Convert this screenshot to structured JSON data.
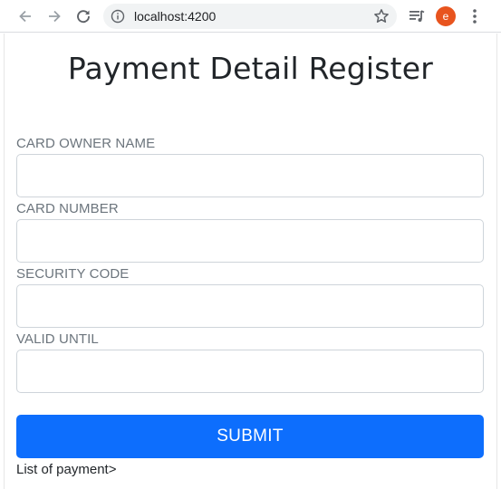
{
  "browser": {
    "url": "localhost:4200",
    "avatar_letter": "e",
    "avatar_color": "#e8541e",
    "icons": [
      "back-arrow-icon",
      "forward-arrow-icon",
      "reload-icon",
      "info-icon",
      "star-icon",
      "media-queue-icon",
      "menu-dots-icon"
    ]
  },
  "page": {
    "title": "Payment Detail Register",
    "fields": [
      {
        "label": "CARD OWNER NAME",
        "value": ""
      },
      {
        "label": "CARD NUMBER",
        "value": ""
      },
      {
        "label": "SECURITY CODE",
        "value": ""
      },
      {
        "label": "VALID UNTIL",
        "value": ""
      }
    ],
    "submit_label": "SUBMIT",
    "list_link": "List of payment>",
    "accent_color": "#0d6efd"
  }
}
